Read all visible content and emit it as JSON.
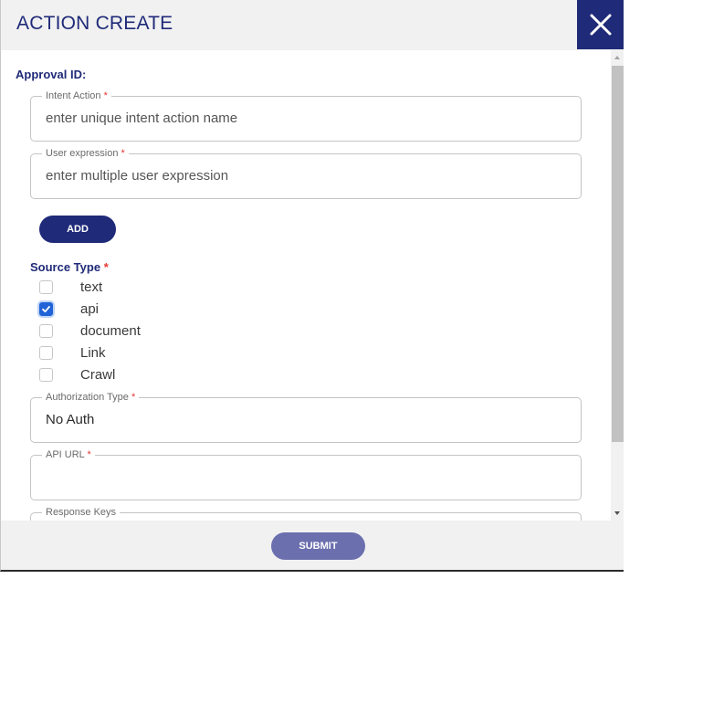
{
  "dialog": {
    "title": "ACTION CREATE",
    "close_icon": "close-icon"
  },
  "form": {
    "approval_label": "Approval ID:",
    "intent_action": {
      "label": "Intent Action",
      "required_mark": "*",
      "placeholder": "enter unique intent action name",
      "value": ""
    },
    "user_expression": {
      "label": "User expression",
      "required_mark": "*",
      "placeholder": "enter multiple user expression",
      "value": ""
    },
    "add_label": "ADD",
    "source_type": {
      "label": "Source Type",
      "required_mark": "*",
      "options": [
        {
          "label": "text",
          "checked": false
        },
        {
          "label": "api",
          "checked": true
        },
        {
          "label": "document",
          "checked": false
        },
        {
          "label": "Link",
          "checked": false
        },
        {
          "label": "Crawl",
          "checked": false
        }
      ]
    },
    "authorization_type": {
      "label": "Authorization Type",
      "required_mark": "*",
      "value": "No Auth"
    },
    "api_url": {
      "label": "API URL",
      "required_mark": "*",
      "value": ""
    },
    "response_keys": {
      "label": "Response Keys"
    }
  },
  "footer": {
    "submit_label": "SUBMIT"
  },
  "colors": {
    "primary": "#1f2a78",
    "submit": "#6b6fae",
    "required": "#e53935",
    "checkbox_checked": "#1f63d6"
  }
}
